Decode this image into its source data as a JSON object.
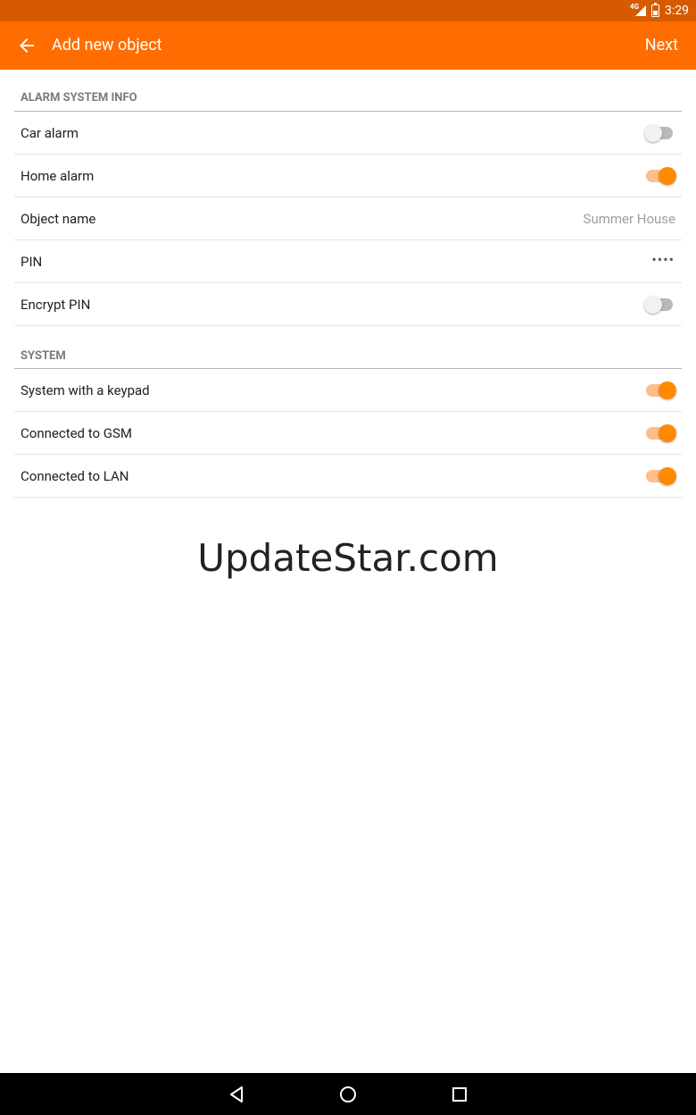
{
  "status_bar": {
    "network": "4G",
    "time": "3:29"
  },
  "toolbar": {
    "title": "Add new object",
    "next_label": "Next"
  },
  "sections": {
    "alarm_info": {
      "header": "ALARM SYSTEM INFO",
      "car_alarm": {
        "label": "Car alarm",
        "enabled": false
      },
      "home_alarm": {
        "label": "Home alarm",
        "enabled": true
      },
      "object_name": {
        "label": "Object name",
        "value": "Summer House"
      },
      "pin": {
        "label": "PIN",
        "value": "••••"
      },
      "encrypt_pin": {
        "label": "Encrypt PIN",
        "enabled": false
      }
    },
    "system": {
      "header": "SYSTEM",
      "keypad": {
        "label": "System with a keypad",
        "enabled": true
      },
      "gsm": {
        "label": "Connected to GSM",
        "enabled": true
      },
      "lan": {
        "label": "Connected to LAN",
        "enabled": true
      }
    }
  },
  "watermark": "UpdateStar.com",
  "colors": {
    "accent": "#ff6d00",
    "status_bar": "#d65b00",
    "switch_on": "#ff8a00"
  }
}
